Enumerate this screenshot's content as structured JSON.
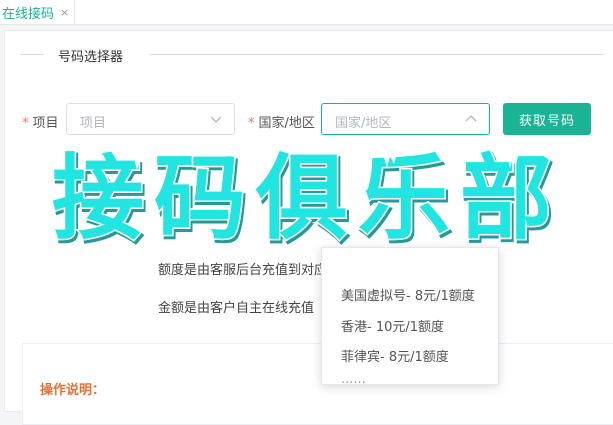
{
  "tabs": [
    {
      "label": "在线接码",
      "close": "×"
    }
  ],
  "section": {
    "legend": "号码选择器"
  },
  "form": {
    "project_label": "项目",
    "project_placeholder": "项目",
    "region_label": "国家/地区",
    "region_placeholder": "国家/地区",
    "get_button": "获取号码",
    "required_mark": "*"
  },
  "notices": [
    "额度是由客服后台充值到对应",
    "金额是由客户自主在线充值"
  ],
  "dropdown": {
    "items": [
      "美国虚拟号- 8元/1额度",
      "香港- 10元/1额度",
      "菲律宾- 8元/1额度"
    ]
  },
  "instructions": {
    "title": "操作说明："
  },
  "watermark": {
    "text": "接码俱乐部",
    "color": "#22e4e0"
  },
  "colors": {
    "accent": "#1ab394",
    "required": "#f56c6c",
    "highlight": "#e6713b"
  },
  "icons": {
    "select_arrow": "chevron-down-icon",
    "open_arrow": "chevron-up-icon"
  }
}
